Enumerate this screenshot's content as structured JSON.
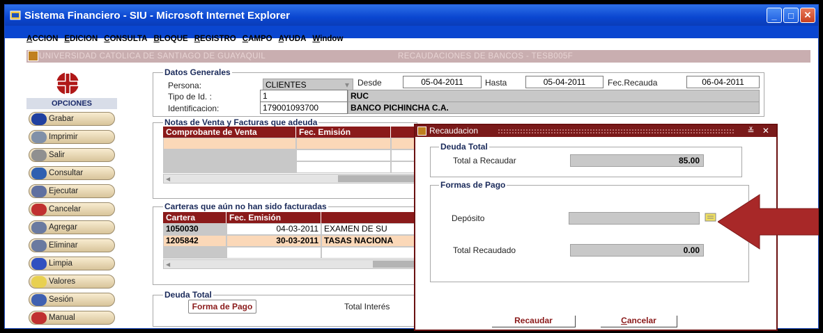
{
  "window": {
    "title": "Sistema Financiero - SIU - Microsoft Internet Explorer",
    "minimize": "_",
    "maximize": "□",
    "close": "✕"
  },
  "menu": [
    {
      "key": "A",
      "rest": "CCION"
    },
    {
      "key": "E",
      "rest": "DICION"
    },
    {
      "key": "C",
      "rest": "ONSULTA"
    },
    {
      "key": "B",
      "rest": "LOQUE"
    },
    {
      "key": "R",
      "rest": "EGISTRO"
    },
    {
      "key": "C",
      "rest": "AMPO"
    },
    {
      "key": "A",
      "rest": "YUDA"
    },
    {
      "key": "W",
      "rest": "indow"
    }
  ],
  "form_title": {
    "left": "UNIVERSIDAD CATOLICA DE SANTIAGO DE GUAYAQUIL",
    "right": "RECAUDACIONES DE BANCOS - TESB005F"
  },
  "sidebar": {
    "title": "OPCIONES",
    "buttons": [
      "Grabar",
      "Imprimir",
      "Salir",
      "Consultar",
      "Ejecutar",
      "Cancelar",
      "Agregar",
      "Eliminar",
      "Limpia",
      "Valores",
      "Sesión",
      "Manual"
    ]
  },
  "datos_generales": {
    "title": "Datos Generales",
    "persona_label": "Persona:",
    "persona_value": "CLIENTES",
    "desde_label": "Desde",
    "desde_value": "05-04-2011",
    "hasta_label": "Hasta",
    "hasta_value": "05-04-2011",
    "fecrecauda_label": "Fec.Recauda",
    "fecrecauda_value": "06-04-2011",
    "tipo_label": "Tipo de Id. :",
    "tipo_value": "1",
    "tipo_desc": "RUC",
    "ident_label": "Identificacion:",
    "ident_value": "179001093700",
    "ident_name": "BANCO PICHINCHA C.A."
  },
  "notas": {
    "title": "Notas de Venta y Facturas que adeuda",
    "columns": [
      "Comprobante de Venta",
      "Fec. Emisión"
    ]
  },
  "carteras": {
    "title": "Carteras que aún no han sido facturadas",
    "columns": [
      "Cartera",
      "Fec. Emisión"
    ],
    "rows": [
      {
        "cartera": "1050030",
        "fecha": "04-03-2011",
        "desc": "EXAMEN DE SU"
      },
      {
        "cartera": "1205842",
        "fecha": "30-03-2011",
        "desc": "TASAS NACIONA"
      }
    ]
  },
  "deuda_total_bottom": {
    "title": "Deuda Total",
    "forma_pago_button": "Forma de Pago",
    "total_interes_label": "Total Interés"
  },
  "dialog": {
    "title": "Recaudacion",
    "controls": "≚ ✕",
    "deuda_total_title": "Deuda Total",
    "total_recaudar_label": "Total a Recaudar",
    "total_recaudar_value": "85.00",
    "formas_pago_title": "Formas de Pago",
    "deposito_label": "Depósito",
    "deposito_value": "",
    "total_recaudado_label": "Total Recaudado",
    "total_recaudado_value": "0.00",
    "recaudar_button": "Recaudar",
    "cancelar_key": "C",
    "cancelar_rest": "ancelar"
  },
  "colors": {
    "titlebar": "#0a46d0",
    "header_red": "#8a1a1a",
    "arrow": "#a82828"
  }
}
